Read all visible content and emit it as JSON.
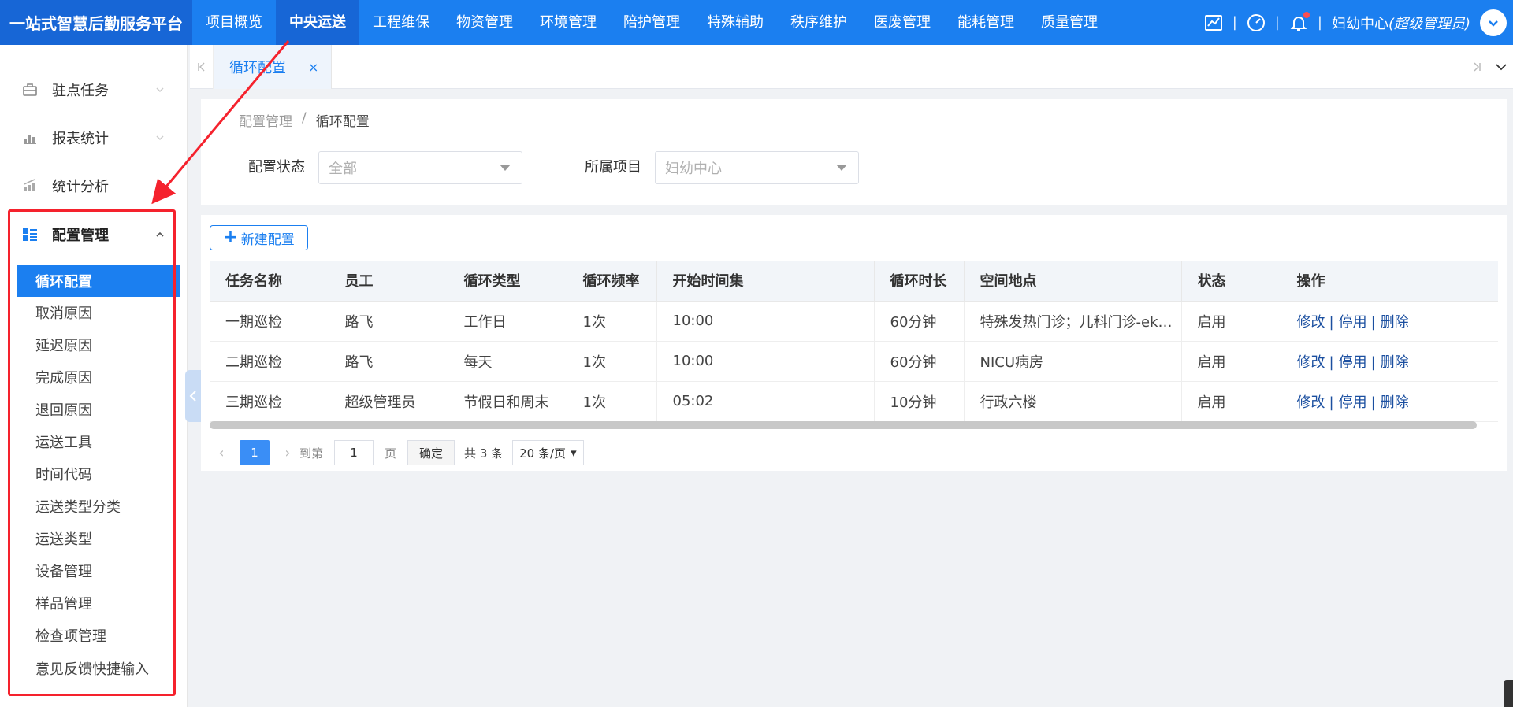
{
  "brand": "一站式智慧后勤服务平台",
  "nav": [
    "项目概览",
    "中央运送",
    "工程维保",
    "物资管理",
    "环境管理",
    "陪护管理",
    "特殊辅助",
    "秩序维护",
    "医废管理",
    "能耗管理",
    "质量管理"
  ],
  "nav_active": "中央运送",
  "top_right": {
    "sep": "|",
    "org": "妇幼中心",
    "role": "(超级管理员)",
    "icons": [
      "chart-icon",
      "dashboard-icon",
      "bell-icon",
      "chevron-down-icon"
    ]
  },
  "sidebar": {
    "items": [
      {
        "label": "驻点任务",
        "icon": "briefcase-icon"
      },
      {
        "label": "报表统计",
        "icon": "bar-chart-icon"
      },
      {
        "label": "统计分析",
        "icon": "analysis-chart-icon"
      },
      {
        "label": "配置管理",
        "icon": "config-list-icon"
      }
    ],
    "subitems": [
      "循环配置",
      "取消原因",
      "延迟原因",
      "完成原因",
      "退回原因",
      "运送工具",
      "时间代码",
      "运送类型分类",
      "运送类型",
      "设备管理",
      "样品管理",
      "检查项管理",
      "意见反馈快捷输入"
    ],
    "active_sub": "循环配置"
  },
  "tabs": [
    {
      "label": "循环配置",
      "close": "×"
    }
  ],
  "breadcrumb": {
    "parent": "配置管理",
    "sep": "/",
    "current": "循环配置"
  },
  "filters": {
    "status_label": "配置状态",
    "status_value": "全部",
    "project_label": "所属项目",
    "project_value": "妇幼中心"
  },
  "new_button": "新建配置",
  "table": {
    "headers": [
      "任务名称",
      "员工",
      "循环类型",
      "循环频率",
      "开始时间集",
      "循环时长",
      "空间地点",
      "状态",
      "操作"
    ],
    "rows": [
      [
        "一期巡检",
        "路飞",
        "工作日",
        "1次",
        "10:00",
        "60分钟",
        "特殊发热门诊；儿科门诊-ek…",
        "启用"
      ],
      [
        "二期巡检",
        "路飞",
        "每天",
        "1次",
        "10:00",
        "60分钟",
        "NICU病房",
        "启用"
      ],
      [
        "三期巡检",
        "超级管理员",
        "节假日和周末",
        "1次",
        "05:02",
        "10分钟",
        "行政六楼",
        "启用"
      ]
    ],
    "ops": [
      "修改",
      "停用",
      "删除"
    ]
  },
  "pager": {
    "current_page": "1",
    "goto_label": "到第",
    "goto_value": "1",
    "page_unit": "页",
    "confirm": "确定",
    "total": "共 3 条",
    "page_size": "20 条/页"
  },
  "colors": {
    "primary": "#1b7ff0",
    "annotation": "#f5222d"
  }
}
